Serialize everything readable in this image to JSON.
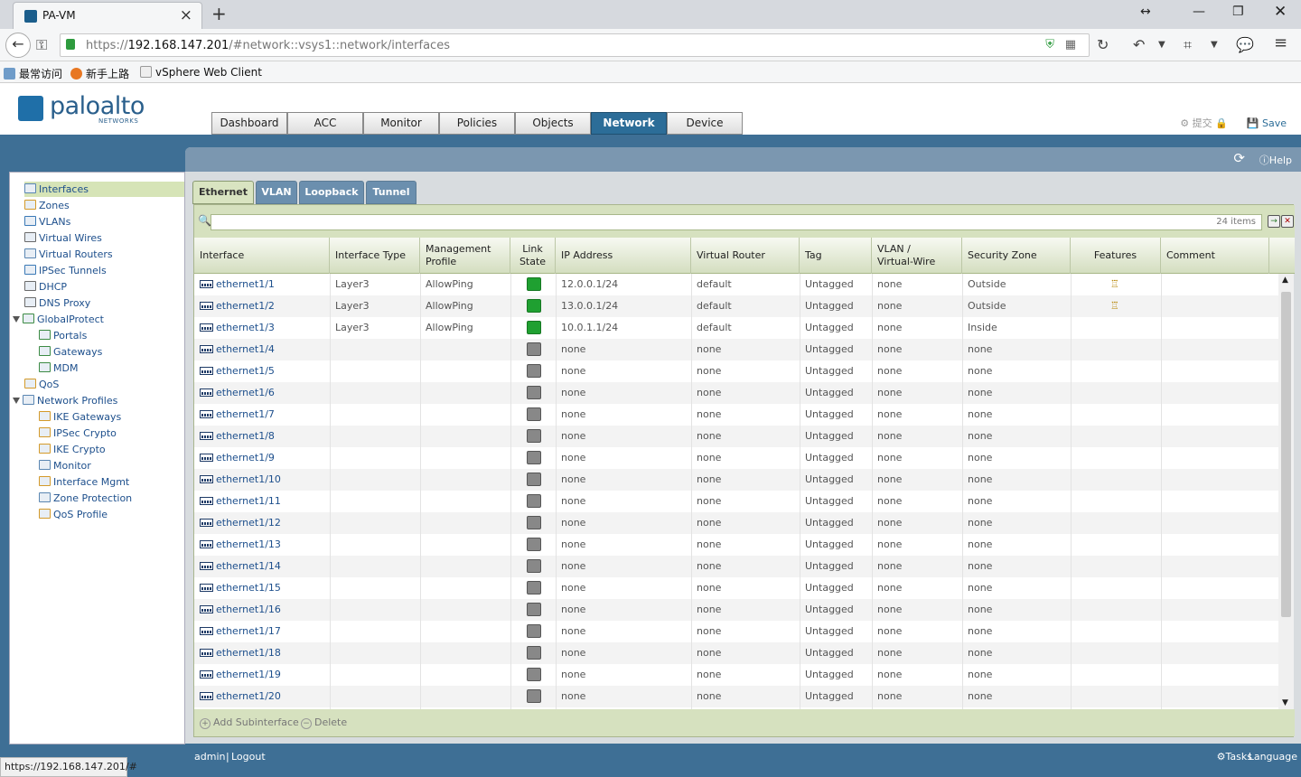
{
  "browser": {
    "tab_title": "PA-VM",
    "url_prefix": "https://",
    "url_host": "192.168.147.201",
    "url_path": "/#network::vsys1::network/interfaces",
    "bookmarks": [
      "最常访问",
      "新手上路",
      "vSphere Web Client"
    ],
    "status_url": "https://192.168.147.201/#"
  },
  "app": {
    "logo_text": "paloalto",
    "logo_sub": "NETWORKS",
    "tabs": [
      "Dashboard",
      "ACC",
      "Monitor",
      "Policies",
      "Objects",
      "Network",
      "Device"
    ],
    "active_tab": "Network",
    "commit_label": "提交",
    "save_label": "Save",
    "help_label": "Help"
  },
  "sidebar": {
    "items": [
      {
        "label": "Interfaces",
        "level": 0,
        "selected": true
      },
      {
        "label": "Zones",
        "level": 0
      },
      {
        "label": "VLANs",
        "level": 0
      },
      {
        "label": "Virtual Wires",
        "level": 0
      },
      {
        "label": "Virtual Routers",
        "level": 0
      },
      {
        "label": "IPSec Tunnels",
        "level": 0
      },
      {
        "label": "DHCP",
        "level": 0
      },
      {
        "label": "DNS Proxy",
        "level": 0
      },
      {
        "label": "GlobalProtect",
        "level": 0,
        "expanded": true
      },
      {
        "label": "Portals",
        "level": 1
      },
      {
        "label": "Gateways",
        "level": 1
      },
      {
        "label": "MDM",
        "level": 1
      },
      {
        "label": "QoS",
        "level": 0
      },
      {
        "label": "Network Profiles",
        "level": 0,
        "expanded": true
      },
      {
        "label": "IKE Gateways",
        "level": 1
      },
      {
        "label": "IPSec Crypto",
        "level": 1
      },
      {
        "label": "IKE Crypto",
        "level": 1
      },
      {
        "label": "Monitor",
        "level": 1
      },
      {
        "label": "Interface Mgmt",
        "level": 1
      },
      {
        "label": "Zone Protection",
        "level": 1
      },
      {
        "label": "QoS Profile",
        "level": 1
      }
    ]
  },
  "subtabs": [
    "Ethernet",
    "VLAN",
    "Loopback",
    "Tunnel"
  ],
  "filter": {
    "count": "24 items"
  },
  "table": {
    "headers": [
      "Interface",
      "Interface Type",
      "Management Profile",
      "Link State",
      "IP Address",
      "Virtual Router",
      "Tag",
      "VLAN / Virtual-Wire",
      "Security Zone",
      "Features",
      "Comment"
    ],
    "header_lines": [
      [
        "Interface"
      ],
      [
        "Interface Type"
      ],
      [
        "Management",
        "Profile"
      ],
      [
        "Link",
        "State"
      ],
      [
        "IP Address"
      ],
      [
        "Virtual Router"
      ],
      [
        "Tag"
      ],
      [
        "VLAN /",
        "Virtual-Wire"
      ],
      [
        "Security Zone"
      ],
      [
        "Features"
      ],
      [
        "Comment"
      ]
    ],
    "rows": [
      {
        "iface": "ethernet1/1",
        "type": "Layer3",
        "mgmt": "AllowPing",
        "link": "up",
        "ip": "12.0.0.1/24",
        "vr": "default",
        "tag": "Untagged",
        "vlan": "none",
        "zone": "Outside",
        "feature": true
      },
      {
        "iface": "ethernet1/2",
        "type": "Layer3",
        "mgmt": "AllowPing",
        "link": "up",
        "ip": "13.0.0.1/24",
        "vr": "default",
        "tag": "Untagged",
        "vlan": "none",
        "zone": "Outside",
        "feature": true
      },
      {
        "iface": "ethernet1/3",
        "type": "Layer3",
        "mgmt": "AllowPing",
        "link": "up",
        "ip": "10.0.1.1/24",
        "vr": "default",
        "tag": "Untagged",
        "vlan": "none",
        "zone": "Inside",
        "feature": false
      },
      {
        "iface": "ethernet1/4",
        "type": "",
        "mgmt": "",
        "link": "down",
        "ip": "none",
        "vr": "none",
        "tag": "Untagged",
        "vlan": "none",
        "zone": "none",
        "feature": false
      },
      {
        "iface": "ethernet1/5",
        "type": "",
        "mgmt": "",
        "link": "down",
        "ip": "none",
        "vr": "none",
        "tag": "Untagged",
        "vlan": "none",
        "zone": "none",
        "feature": false
      },
      {
        "iface": "ethernet1/6",
        "type": "",
        "mgmt": "",
        "link": "down",
        "ip": "none",
        "vr": "none",
        "tag": "Untagged",
        "vlan": "none",
        "zone": "none",
        "feature": false
      },
      {
        "iface": "ethernet1/7",
        "type": "",
        "mgmt": "",
        "link": "down",
        "ip": "none",
        "vr": "none",
        "tag": "Untagged",
        "vlan": "none",
        "zone": "none",
        "feature": false
      },
      {
        "iface": "ethernet1/8",
        "type": "",
        "mgmt": "",
        "link": "down",
        "ip": "none",
        "vr": "none",
        "tag": "Untagged",
        "vlan": "none",
        "zone": "none",
        "feature": false
      },
      {
        "iface": "ethernet1/9",
        "type": "",
        "mgmt": "",
        "link": "down",
        "ip": "none",
        "vr": "none",
        "tag": "Untagged",
        "vlan": "none",
        "zone": "none",
        "feature": false
      },
      {
        "iface": "ethernet1/10",
        "type": "",
        "mgmt": "",
        "link": "down",
        "ip": "none",
        "vr": "none",
        "tag": "Untagged",
        "vlan": "none",
        "zone": "none",
        "feature": false
      },
      {
        "iface": "ethernet1/11",
        "type": "",
        "mgmt": "",
        "link": "down",
        "ip": "none",
        "vr": "none",
        "tag": "Untagged",
        "vlan": "none",
        "zone": "none",
        "feature": false
      },
      {
        "iface": "ethernet1/12",
        "type": "",
        "mgmt": "",
        "link": "down",
        "ip": "none",
        "vr": "none",
        "tag": "Untagged",
        "vlan": "none",
        "zone": "none",
        "feature": false
      },
      {
        "iface": "ethernet1/13",
        "type": "",
        "mgmt": "",
        "link": "down",
        "ip": "none",
        "vr": "none",
        "tag": "Untagged",
        "vlan": "none",
        "zone": "none",
        "feature": false
      },
      {
        "iface": "ethernet1/14",
        "type": "",
        "mgmt": "",
        "link": "down",
        "ip": "none",
        "vr": "none",
        "tag": "Untagged",
        "vlan": "none",
        "zone": "none",
        "feature": false
      },
      {
        "iface": "ethernet1/15",
        "type": "",
        "mgmt": "",
        "link": "down",
        "ip": "none",
        "vr": "none",
        "tag": "Untagged",
        "vlan": "none",
        "zone": "none",
        "feature": false
      },
      {
        "iface": "ethernet1/16",
        "type": "",
        "mgmt": "",
        "link": "down",
        "ip": "none",
        "vr": "none",
        "tag": "Untagged",
        "vlan": "none",
        "zone": "none",
        "feature": false
      },
      {
        "iface": "ethernet1/17",
        "type": "",
        "mgmt": "",
        "link": "down",
        "ip": "none",
        "vr": "none",
        "tag": "Untagged",
        "vlan": "none",
        "zone": "none",
        "feature": false
      },
      {
        "iface": "ethernet1/18",
        "type": "",
        "mgmt": "",
        "link": "down",
        "ip": "none",
        "vr": "none",
        "tag": "Untagged",
        "vlan": "none",
        "zone": "none",
        "feature": false
      },
      {
        "iface": "ethernet1/19",
        "type": "",
        "mgmt": "",
        "link": "down",
        "ip": "none",
        "vr": "none",
        "tag": "Untagged",
        "vlan": "none",
        "zone": "none",
        "feature": false
      },
      {
        "iface": "ethernet1/20",
        "type": "",
        "mgmt": "",
        "link": "down",
        "ip": "none",
        "vr": "none",
        "tag": "Untagged",
        "vlan": "none",
        "zone": "none",
        "feature": false
      }
    ]
  },
  "footer": {
    "add_label": "Add Subinterface",
    "delete_label": "Delete"
  },
  "statusbar": {
    "user": "admin",
    "logout": "Logout",
    "tasks": "Tasks",
    "language": "Language"
  },
  "colors": {
    "brand": "#2c6d98",
    "link_up": "#1fa031",
    "link_down": "#888888",
    "panel_green": "#d6e1bf"
  }
}
